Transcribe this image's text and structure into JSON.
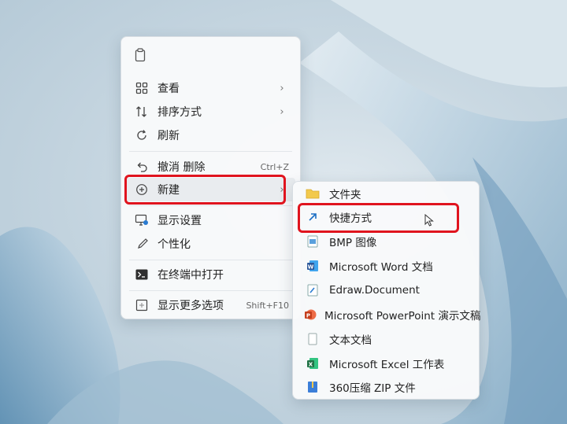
{
  "context_menu": {
    "top_icon": "paste-icon",
    "items": [
      {
        "label": "查看",
        "icon": "view-grid-icon",
        "has_submenu": true
      },
      {
        "label": "排序方式",
        "icon": "sort-icon",
        "has_submenu": true
      },
      {
        "label": "刷新",
        "icon": "refresh-icon"
      },
      {
        "label": "撤消 删除",
        "icon": "undo-icon",
        "shortcut": "Ctrl+Z"
      },
      {
        "label": "新建",
        "icon": "new-plus-icon",
        "has_submenu": true
      },
      {
        "label": "显示设置",
        "icon": "display-settings-icon"
      },
      {
        "label": "个性化",
        "icon": "personalize-brush-icon"
      },
      {
        "label": "在终端中打开",
        "icon": "terminal-icon"
      },
      {
        "label": "显示更多选项",
        "icon": "more-options-icon",
        "shortcut": "Shift+F10"
      }
    ]
  },
  "new_submenu": {
    "items": [
      {
        "label": "文件夹",
        "icon": "folder-icon"
      },
      {
        "label": "快捷方式",
        "icon": "shortcut-arrow-icon"
      },
      {
        "label": "BMP 图像",
        "icon": "bmp-image-icon"
      },
      {
        "label": "Microsoft Word 文档",
        "icon": "word-icon"
      },
      {
        "label": "Edraw.Document",
        "icon": "edraw-icon"
      },
      {
        "label": "Microsoft PowerPoint 演示文稿",
        "icon": "powerpoint-icon"
      },
      {
        "label": "文本文档",
        "icon": "text-document-icon"
      },
      {
        "label": "Microsoft Excel 工作表",
        "icon": "excel-icon"
      },
      {
        "label": "360压缩 ZIP 文件",
        "icon": "zip-icon"
      }
    ]
  },
  "colors": {
    "highlight_box": "#e0141e",
    "word": "#2b579a",
    "excel": "#217346",
    "powerpoint": "#d24726",
    "folder": "#f2c94c"
  }
}
